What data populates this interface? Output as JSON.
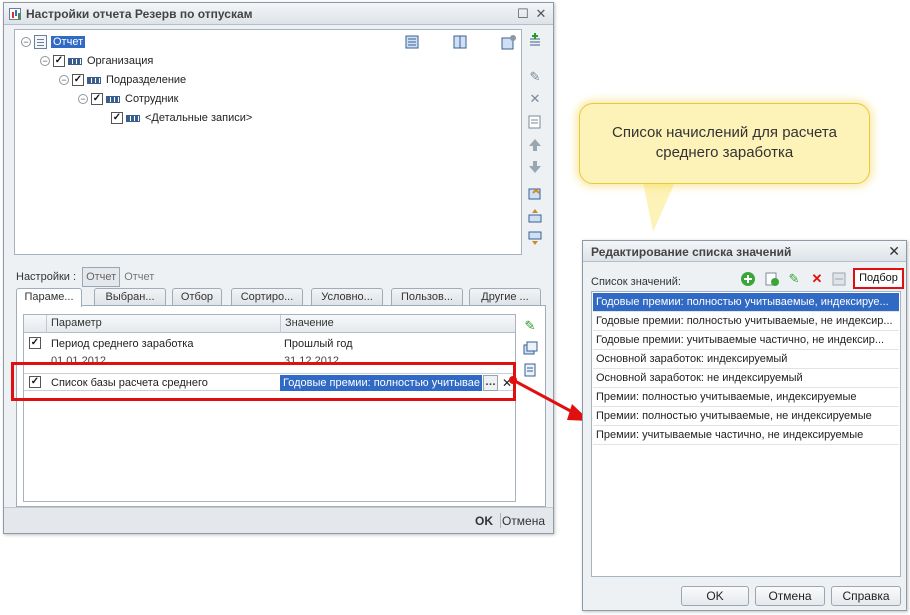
{
  "main_window": {
    "title": "Настройки отчета  Резерв по отпускам",
    "tree": [
      {
        "label": "Отчет"
      },
      {
        "label": "Организация"
      },
      {
        "label": "Подразделение"
      },
      {
        "label": "Сотрудник"
      },
      {
        "label": "<Детальные записи>"
      }
    ],
    "settings_label": "Настройки :",
    "settings_btn": "Отчет",
    "settings_link": "Отчет",
    "tabs": [
      "Параме...",
      "Выбран...",
      "Отбор",
      "Сортиро...",
      "Условно...",
      "Пользов...",
      "Другие ..."
    ],
    "grid": {
      "col_param": "Параметр",
      "col_value": "Значение",
      "rows": [
        {
          "param": "Период среднего заработка",
          "value": "Прошлый год",
          "sub_left": "01.01.2012",
          "sub_right": "31.12.2012"
        },
        {
          "param": "Список базы расчета среднего",
          "value": "Годовые премии: полностью учитывае"
        }
      ]
    },
    "footer": {
      "ok": "OK",
      "cancel": "Отмена"
    }
  },
  "callout": {
    "line1": "Список начислений для расчета",
    "line2": "среднего заработка"
  },
  "edit_window": {
    "title": "Редактирование списка значений",
    "list_label": "Список значений:",
    "podbor": "Подбор",
    "items": [
      "Годовые премии: полностью учитываемые, индексируе...",
      "Годовые премии: полностью учитываемые, не индексир...",
      "Годовые премии: учитываемые частично, не индексир...",
      "Основной заработок: индексируемый",
      "Основной заработок: не индексируемый",
      "Премии: полностью учитываемые, индексируемые",
      "Премии: полностью учитываемые, не индексируемые",
      "Премии: учитываемые частично, не индексируемые"
    ],
    "buttons": {
      "ok": "OK",
      "cancel": "Отмена",
      "help": "Справка"
    }
  },
  "colors": {
    "selection": "#316ac5",
    "highlight_red": "#e01010",
    "callout_bg": "#fdf3b8"
  },
  "icons": [
    "report-icon",
    "group-icon",
    "add-icon",
    "edit-icon",
    "delete-icon",
    "move-up-icon",
    "move-down-icon",
    "close-icon"
  ]
}
